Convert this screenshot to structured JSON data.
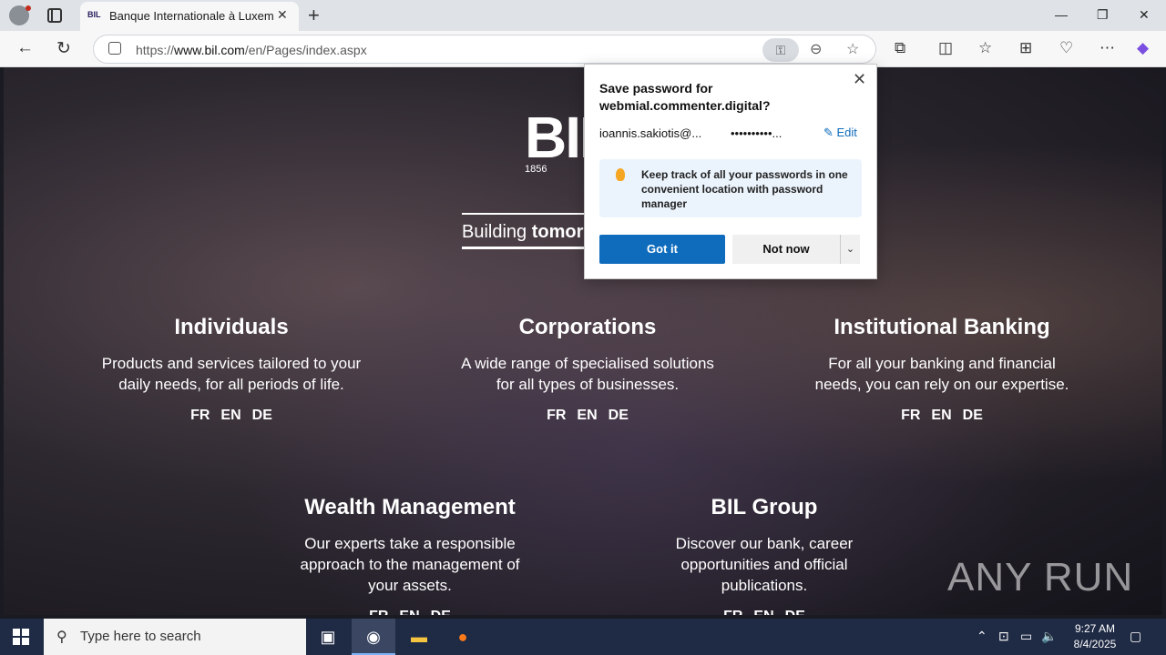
{
  "browser": {
    "tab_title": "Banque Internationale à Luxembourg",
    "tab_favicon_text": "BIL",
    "url_prefix": "https://",
    "url_domain": "www.bil.com",
    "url_path": "/en/Pages/index.aspx"
  },
  "page": {
    "logo_text": "BIL",
    "logo_year": "1856",
    "tagline_plain": "Building ",
    "tagline_bold": "tomorrow",
    "sections": [
      {
        "title": "Individuals",
        "desc": "Products and services tailored to your daily needs, for all periods of life.",
        "langs": [
          "FR",
          "EN",
          "DE"
        ]
      },
      {
        "title": "Corporations",
        "desc": "A wide range of specialised solutions for all types of businesses.",
        "langs": [
          "FR",
          "EN",
          "DE"
        ]
      },
      {
        "title": "Institutional Banking",
        "desc": "For all your banking and financial needs, you can rely on our expertise.",
        "langs": [
          "FR",
          "EN",
          "DE"
        ]
      },
      {
        "title": "Wealth Management",
        "desc": "Our experts take a responsible approach to the management of your assets.",
        "langs": [
          "FR",
          "EN",
          "DE"
        ]
      },
      {
        "title": "BIL Group",
        "desc": "Discover our bank, career opportunities and official publications.",
        "langs": [
          "FR",
          "EN",
          "DE"
        ]
      }
    ],
    "watermark": "ANY RUN"
  },
  "password_popup": {
    "title": "Save password for webmial.commenter.digital?",
    "username": "ioannis.sakiotis@...",
    "password_masked": "••••••••••...",
    "edit_label": "Edit",
    "tip": "Keep track of all your passwords in one convenient location with password manager",
    "got_it_label": "Got it",
    "not_now_label": "Not now"
  },
  "taskbar": {
    "search_placeholder": "Type here to search",
    "time": "9:27 AM",
    "date": "8/4/2025"
  },
  "colors": {
    "accent": "#0f6cbd",
    "taskbar": "#1f2a44"
  }
}
